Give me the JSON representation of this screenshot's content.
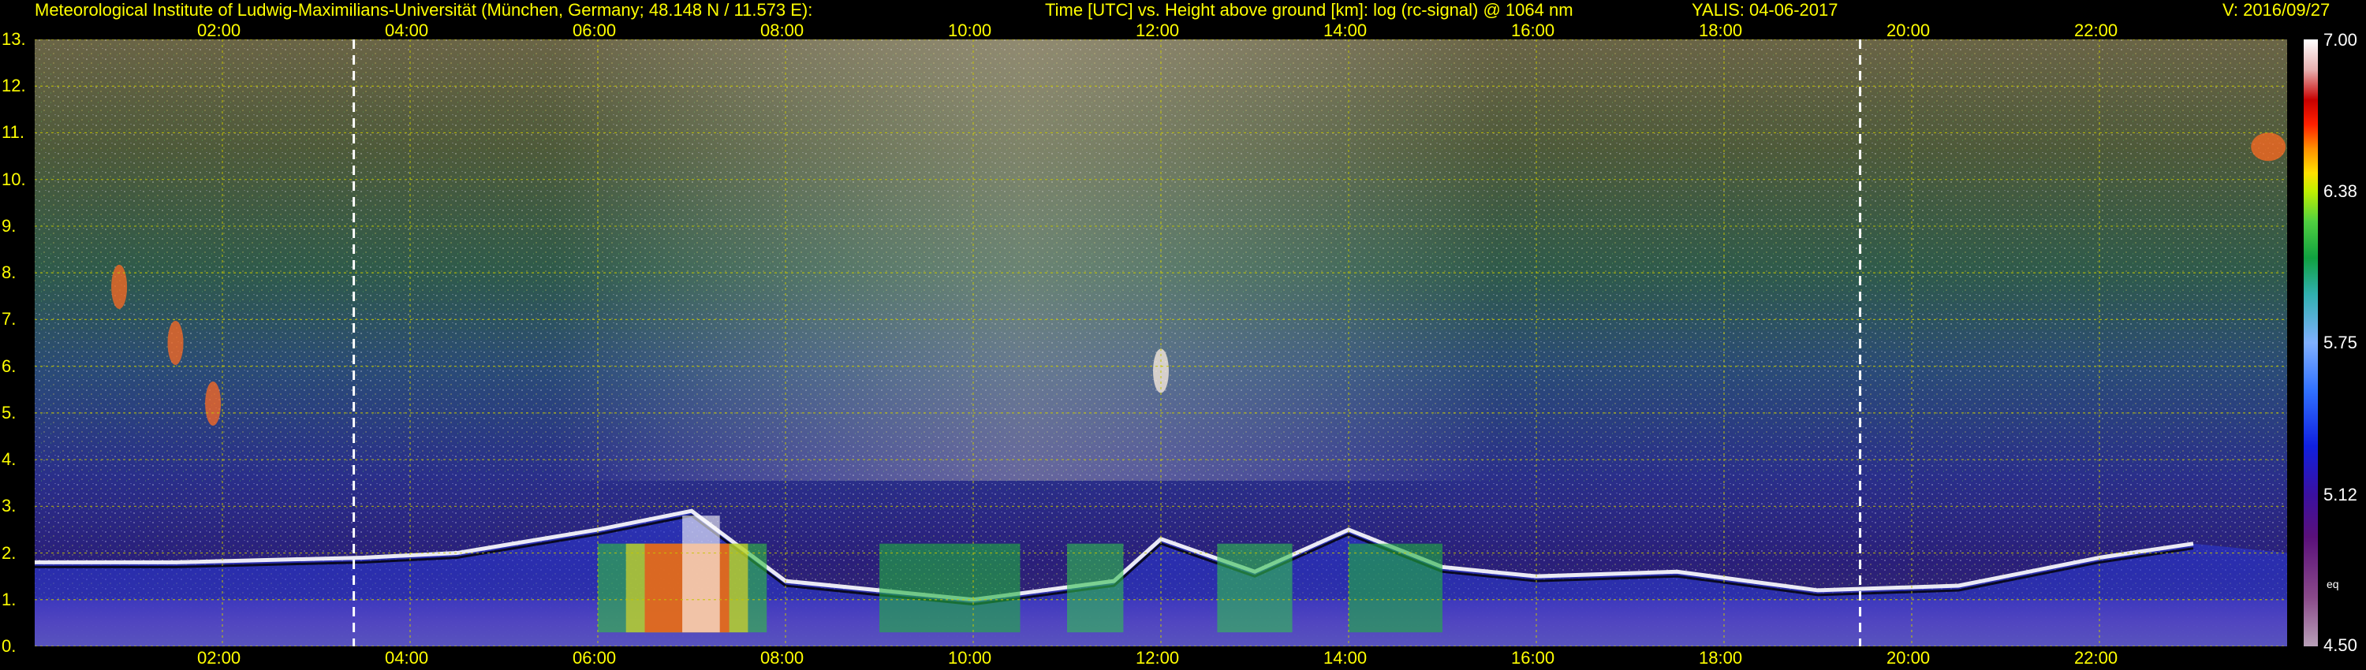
{
  "header": {
    "institute": "Meteorological Institute of Ludwig-Maximilians-Universität (München, Germany; 48.148 N / 11.573 E):",
    "axes_title": "Time [UTC] vs. Height above ground [km]: log (rc-signal) @ 1064 nm",
    "instrument_date": "YALIS: 04-06-2017",
    "version": "V: 2016/09/27"
  },
  "colors": {
    "header_text": "#ffff00",
    "axis_text": "#ffff00",
    "grid": "#c8c800",
    "background": "#000000",
    "marker_lines": "#ffffff"
  },
  "chart_data": {
    "type": "heatmap",
    "title": "Time [UTC] vs. Height above ground [km]: log (rc-signal) @ 1064 nm",
    "xlabel": "Time [UTC]",
    "ylabel": "Height above ground [km]",
    "x_tick_labels": [
      "02:00",
      "04:00",
      "06:00",
      "08:00",
      "10:00",
      "12:00",
      "14:00",
      "16:00",
      "18:00",
      "20:00",
      "22:00"
    ],
    "x_tick_hours": [
      2,
      4,
      6,
      8,
      10,
      12,
      14,
      16,
      18,
      20,
      22
    ],
    "xlim_hours": [
      0,
      24
    ],
    "y_tick_labels": [
      "0.",
      "1.",
      "2.",
      "3.",
      "4.",
      "5.",
      "6.",
      "7.",
      "8.",
      "9.",
      "10.",
      "11.",
      "12.",
      "13."
    ],
    "ylim_km": [
      0,
      13
    ],
    "grid": true,
    "colorbar": {
      "tick_labels": [
        "7.00",
        "6.38",
        "5.75",
        "5.12",
        "4.50"
      ],
      "tick_values": [
        7.0,
        6.375,
        5.75,
        5.125,
        4.5
      ],
      "range": [
        4.5,
        7.0
      ],
      "unit_label": "eq"
    },
    "vertical_markers_hours": [
      3.4,
      19.45
    ],
    "features": [
      {
        "name": "boundary layer top",
        "points": [
          [
            0.0,
            1.8
          ],
          [
            1.5,
            1.8
          ],
          [
            3.5,
            1.9
          ],
          [
            4.5,
            2.0
          ],
          [
            6.0,
            2.5
          ],
          [
            7.0,
            2.9
          ],
          [
            8.0,
            1.4
          ],
          [
            10.0,
            1.0
          ],
          [
            11.5,
            1.4
          ],
          [
            12.0,
            2.3
          ],
          [
            13.0,
            1.6
          ],
          [
            14.0,
            2.5
          ],
          [
            15.0,
            1.7
          ],
          [
            16.0,
            1.5
          ],
          [
            17.5,
            1.6
          ],
          [
            19.0,
            1.2
          ],
          [
            20.5,
            1.3
          ],
          [
            22.0,
            1.9
          ],
          [
            23.0,
            2.2
          ]
        ]
      },
      {
        "name": "cirrus",
        "points": [
          [
            0.9,
            7.7
          ],
          [
            1.5,
            6.5
          ],
          [
            1.9,
            5.2
          ],
          [
            12.0,
            5.9
          ],
          [
            23.8,
            10.7
          ]
        ]
      }
    ]
  }
}
